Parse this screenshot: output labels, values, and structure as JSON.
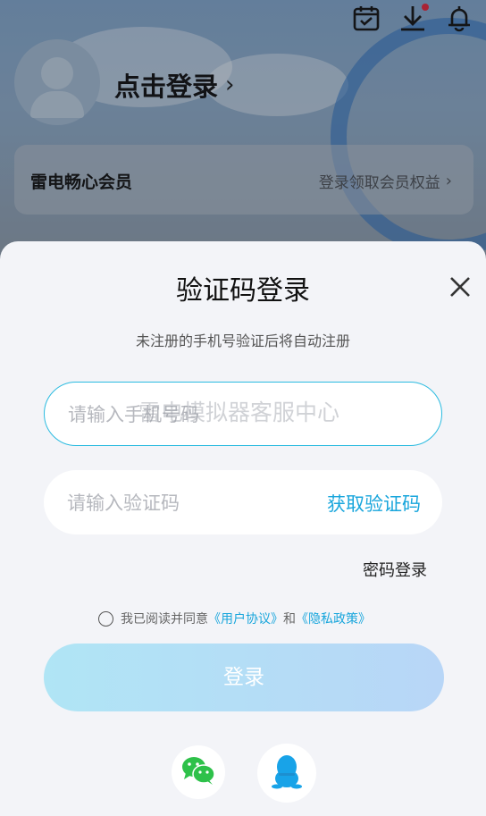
{
  "header": {
    "login_prompt": "点击登录",
    "member_title": "雷电畅心会员",
    "member_link": "登录领取会员权益"
  },
  "modal": {
    "title": "验证码登录",
    "subtitle": "未注册的手机号验证后将自动注册",
    "phone_placeholder": "请输入手机号码",
    "watermark": "雷电模拟器客服中心",
    "code_placeholder": "请输入验证码",
    "get_code_label": "获取验证码",
    "password_login_label": "密码登录",
    "agreement_prefix": "我已阅读并同意",
    "user_agreement": "《用户协议》",
    "agreement_and": "和",
    "privacy_policy": "《隐私政策》",
    "login_button": "登录"
  },
  "social": [
    "wechat-icon",
    "qq-icon"
  ],
  "colors": {
    "accent": "#19a6dc",
    "input_border": "#2bbbe0",
    "button_gradient_start": "#b0e5f5",
    "button_gradient_end": "#b8d6f7",
    "sheet_bg": "#f3f4f8",
    "notification_dot": "#e0243a",
    "wechat_green": "#2ec14a",
    "qq_blue": "#18a3e8"
  }
}
